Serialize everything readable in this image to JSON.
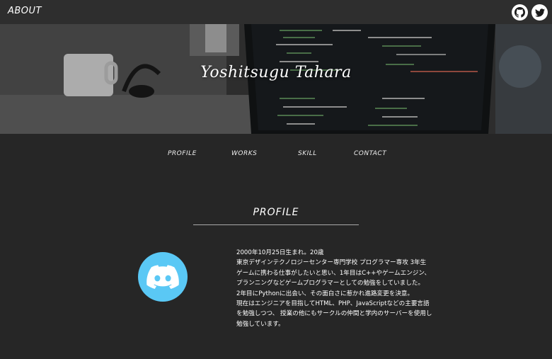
{
  "header": {
    "brand": "ABOUT",
    "social": [
      {
        "icon": "github-icon",
        "label": "GitHub"
      },
      {
        "icon": "twitter-icon",
        "label": "Twitter"
      }
    ]
  },
  "hero": {
    "title": "Yoshitsugu Tahara"
  },
  "nav": {
    "items": [
      "PROFILE",
      "WORKS",
      "SKILL",
      "CONTACT"
    ]
  },
  "profile": {
    "heading": "PROFILE",
    "avatar_icon": "discord-icon",
    "bio_lines": [
      "2000年10月25日生まれ。20歳",
      "東京デザインテクノロジーセンター専門学校 プログラマー専攻 3年生",
      "ゲームに携わる仕事がしたいと思い、1年目はC++やゲームエンジン、",
      "プランニングなどゲームプログラマーとしての勉強をしていました。",
      "2年目にPythonに出会い、その面白さに惹かれ進路変更を決意。",
      "現在はエンジニアを目指してHTML、PHP、JavaScriptなどの主要言語",
      "を勉強しつつ、 授業の他にもサークルの仲間と学内のサーバーを使用し",
      "勉強しています。"
    ]
  },
  "colors": {
    "background": "#262626",
    "topbar": "#2e2e2e",
    "avatar": "#5ac8f5",
    "rule": "#a9a9a9"
  }
}
